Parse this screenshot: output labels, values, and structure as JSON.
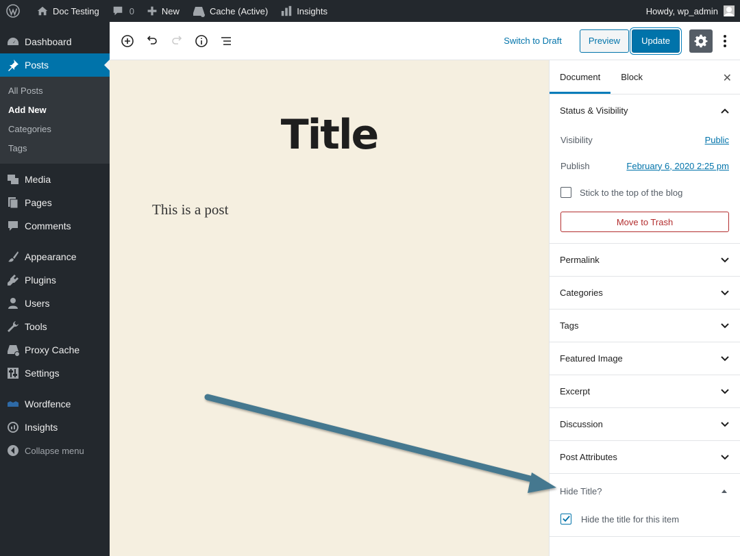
{
  "adminbar": {
    "site_name": "Doc Testing",
    "comments_count": "0",
    "new_label": "New",
    "cache_label": "Cache (Active)",
    "insights_label": "Insights",
    "howdy": "Howdy, wp_admin"
  },
  "sidebar": {
    "dashboard": "Dashboard",
    "posts": "Posts",
    "posts_sub": [
      "All Posts",
      "Add New",
      "Categories",
      "Tags"
    ],
    "media": "Media",
    "pages": "Pages",
    "comments": "Comments",
    "appearance": "Appearance",
    "plugins": "Plugins",
    "users": "Users",
    "tools": "Tools",
    "proxy_cache": "Proxy Cache",
    "settings": "Settings",
    "wordfence": "Wordfence",
    "insights": "Insights",
    "collapse": "Collapse menu"
  },
  "toolbar": {
    "switch_to_draft": "Switch to Draft",
    "preview": "Preview",
    "update": "Update"
  },
  "post": {
    "title": "Title",
    "body": "This is a post"
  },
  "settings_panel": {
    "tabs": [
      "Document",
      "Block"
    ],
    "status_visibility": "Status & Visibility",
    "visibility_label": "Visibility",
    "visibility_value": "Public",
    "publish_label": "Publish",
    "publish_value": "February 6, 2020 2:25 pm",
    "sticky_label": "Stick to the top of the blog",
    "sticky_checked": false,
    "trash_label": "Move to Trash",
    "sections": [
      "Permalink",
      "Categories",
      "Tags",
      "Featured Image",
      "Excerpt",
      "Discussion",
      "Post Attributes"
    ],
    "hide_title_heading": "Hide Title?",
    "hide_title_option": "Hide the title for this item",
    "hide_title_checked": true
  },
  "colors": {
    "admin_dark": "#23282d",
    "accent": "#0073aa",
    "canvas_bg": "#f5efe0",
    "arrow": "#44788f",
    "trash_red": "#b32d2e"
  },
  "icons": [
    "wordpress-logo-icon",
    "home-icon",
    "comment-icon",
    "plus-icon",
    "cache-icon",
    "chart-icon",
    "add-block-icon",
    "undo-icon",
    "redo-icon",
    "info-icon",
    "list-view-icon",
    "gear-icon",
    "more-vertical-icon",
    "close-icon",
    "chevron-up-icon",
    "chevron-down-icon",
    "checkmark-icon",
    "arrow-annotation"
  ]
}
